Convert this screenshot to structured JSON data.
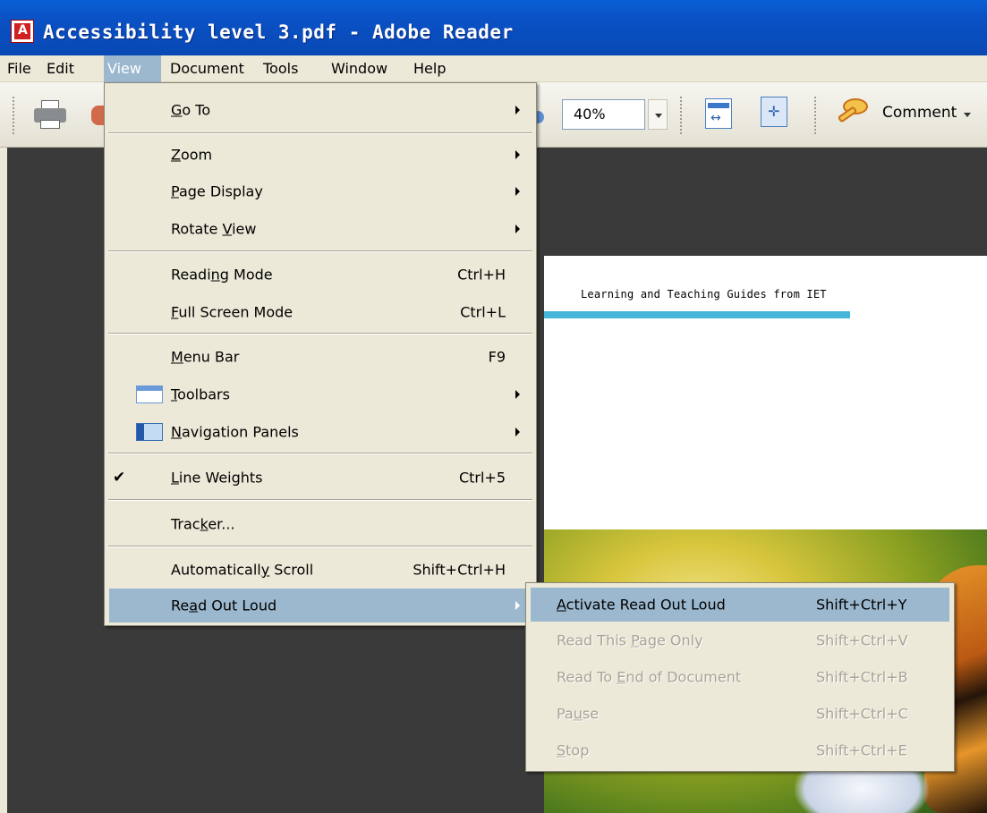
{
  "window": {
    "title": "Accessibility level 3.pdf - Adobe Reader"
  },
  "menubar": {
    "items": [
      "File",
      "Edit",
      "View",
      "Document",
      "Tools",
      "Window",
      "Help"
    ],
    "active": "View"
  },
  "toolbar": {
    "zoom_value": "40%",
    "comment_label": "Comment"
  },
  "document": {
    "header_text": "Learning and Teaching Guides from IET",
    "rule_color": "#45b5d8"
  },
  "view_menu": {
    "items": [
      {
        "label_pre": "",
        "label_u": "G",
        "label_post": "o To",
        "shortcut": "",
        "submenu": true
      },
      {
        "label_pre": "",
        "label_u": "Z",
        "label_post": "oom",
        "shortcut": "",
        "submenu": true
      },
      {
        "label_pre": "",
        "label_u": "P",
        "label_post": "age Display",
        "shortcut": "",
        "submenu": true
      },
      {
        "label_pre": "Rotate ",
        "label_u": "V",
        "label_post": "iew",
        "shortcut": "",
        "submenu": true
      },
      {
        "label_pre": "Readi",
        "label_u": "n",
        "label_post": "g Mode",
        "shortcut": "Ctrl+H",
        "submenu": false
      },
      {
        "label_pre": "",
        "label_u": "F",
        "label_post": "ull Screen Mode",
        "shortcut": "Ctrl+L",
        "submenu": false
      },
      {
        "label_pre": "",
        "label_u": "M",
        "label_post": "enu Bar",
        "shortcut": "F9",
        "submenu": false
      },
      {
        "label_pre": "",
        "label_u": "T",
        "label_post": "oolbars",
        "shortcut": "",
        "submenu": true
      },
      {
        "label_pre": "",
        "label_u": "N",
        "label_post": "avigation Panels",
        "shortcut": "",
        "submenu": true
      },
      {
        "label_pre": "",
        "label_u": "L",
        "label_post": "ine Weights",
        "shortcut": "Ctrl+5",
        "submenu": false,
        "checked": true
      },
      {
        "label_pre": "Trac",
        "label_u": "k",
        "label_post": "er...",
        "shortcut": "",
        "submenu": false
      },
      {
        "label_pre": "Automaticall",
        "label_u": "y",
        "label_post": " Scroll",
        "shortcut": "Shift+Ctrl+H",
        "submenu": false
      },
      {
        "label_pre": "Re",
        "label_u": "a",
        "label_post": "d Out Loud",
        "shortcut": "",
        "submenu": true,
        "highlighted": true
      }
    ],
    "check_glyph": "✔"
  },
  "read_out_loud_menu": {
    "items": [
      {
        "label_pre": "",
        "label_u": "A",
        "label_post": "ctivate Read Out Loud",
        "shortcut": "Shift+Ctrl+Y",
        "enabled": true,
        "highlighted": true
      },
      {
        "label_pre": "Read This ",
        "label_u": "P",
        "label_post": "age Only",
        "shortcut": "Shift+Ctrl+V",
        "enabled": false
      },
      {
        "label_pre": "Read To ",
        "label_u": "E",
        "label_post": "nd of Document",
        "shortcut": "Shift+Ctrl+B",
        "enabled": false
      },
      {
        "label_pre": "Pa",
        "label_u": "u",
        "label_post": "se",
        "shortcut": "Shift+Ctrl+C",
        "enabled": false
      },
      {
        "label_pre": "",
        "label_u": "S",
        "label_post": "top",
        "shortcut": "Shift+Ctrl+E",
        "enabled": false
      }
    ]
  },
  "colors": {
    "menu_highlight": "#9cb8cf",
    "menu_bg": "#ece9d8",
    "titlebar": "#0a52c6",
    "doc_bg": "#3a3a3a"
  }
}
